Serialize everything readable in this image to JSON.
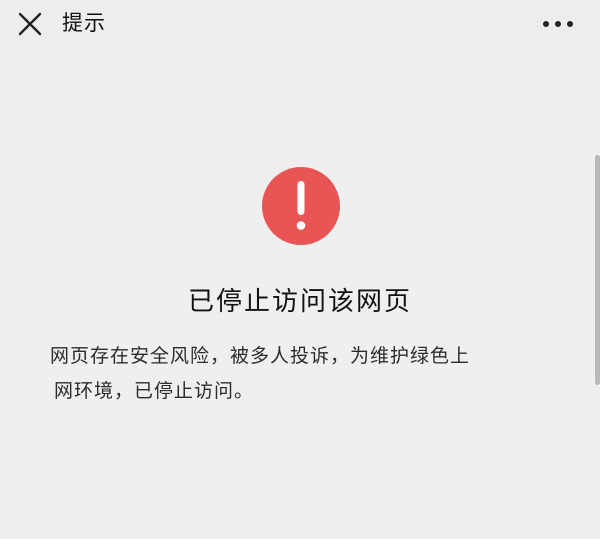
{
  "topbar": {
    "title": "提示",
    "close_icon": "close-icon",
    "more_icon": "more-icon"
  },
  "alert": {
    "icon": "exclamation-icon",
    "icon_color": "#e95454",
    "heading": "已停止访问该网页",
    "message_lines": [
      "网页存在安全风险，被多人投诉，为维护绿色上",
      "网环境，已停止访问。"
    ]
  }
}
